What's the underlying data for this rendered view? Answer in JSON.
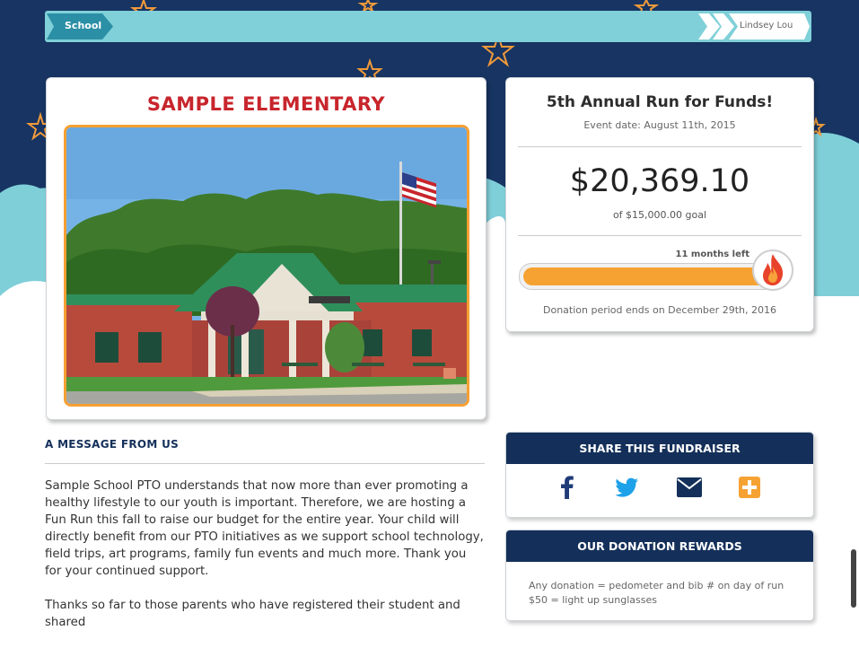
{
  "breadcrumb": {
    "school": "School",
    "user": "Lindsey Lou"
  },
  "school": {
    "name": "SAMPLE ELEMENTARY"
  },
  "fundraiser": {
    "title": "5th Annual Run for Funds!",
    "event_date": "Event date: August 11th, 2015",
    "amount": "$20,369.10",
    "goal": "of $15,000.00 goal",
    "time_left": "11 months left",
    "progress": 1.0,
    "period": "Donation period ends on December 29th, 2016"
  },
  "message": {
    "heading": "A MESSAGE FROM US",
    "paragraphs": [
      "Sample School PTO understands that now more than ever promoting a healthy lifestyle to our youth is important. Therefore, we are hosting a Fun Run this fall to raise our budget for the entire year. Your child will directly benefit from our PTO initiatives as we support school technology, field trips, art programs, family fun events and much more. Thank you for your continued support.",
      "Thanks so far to those parents who have registered their student and shared"
    ]
  },
  "share": {
    "heading": "SHARE THIS FUNDRAISER",
    "buttons": [
      "facebook-icon",
      "twitter-icon",
      "email-icon",
      "more-share-icon"
    ]
  },
  "rewards": {
    "heading": "OUR DONATION REWARDS",
    "items": [
      "Any donation = pedometer and bib # on day of run",
      "$50 = light up sunglasses"
    ]
  },
  "colors": {
    "navy": "#14305a",
    "accent_orange": "#f6a232",
    "title_red": "#c8252c",
    "teal": "#7fd0d8"
  }
}
